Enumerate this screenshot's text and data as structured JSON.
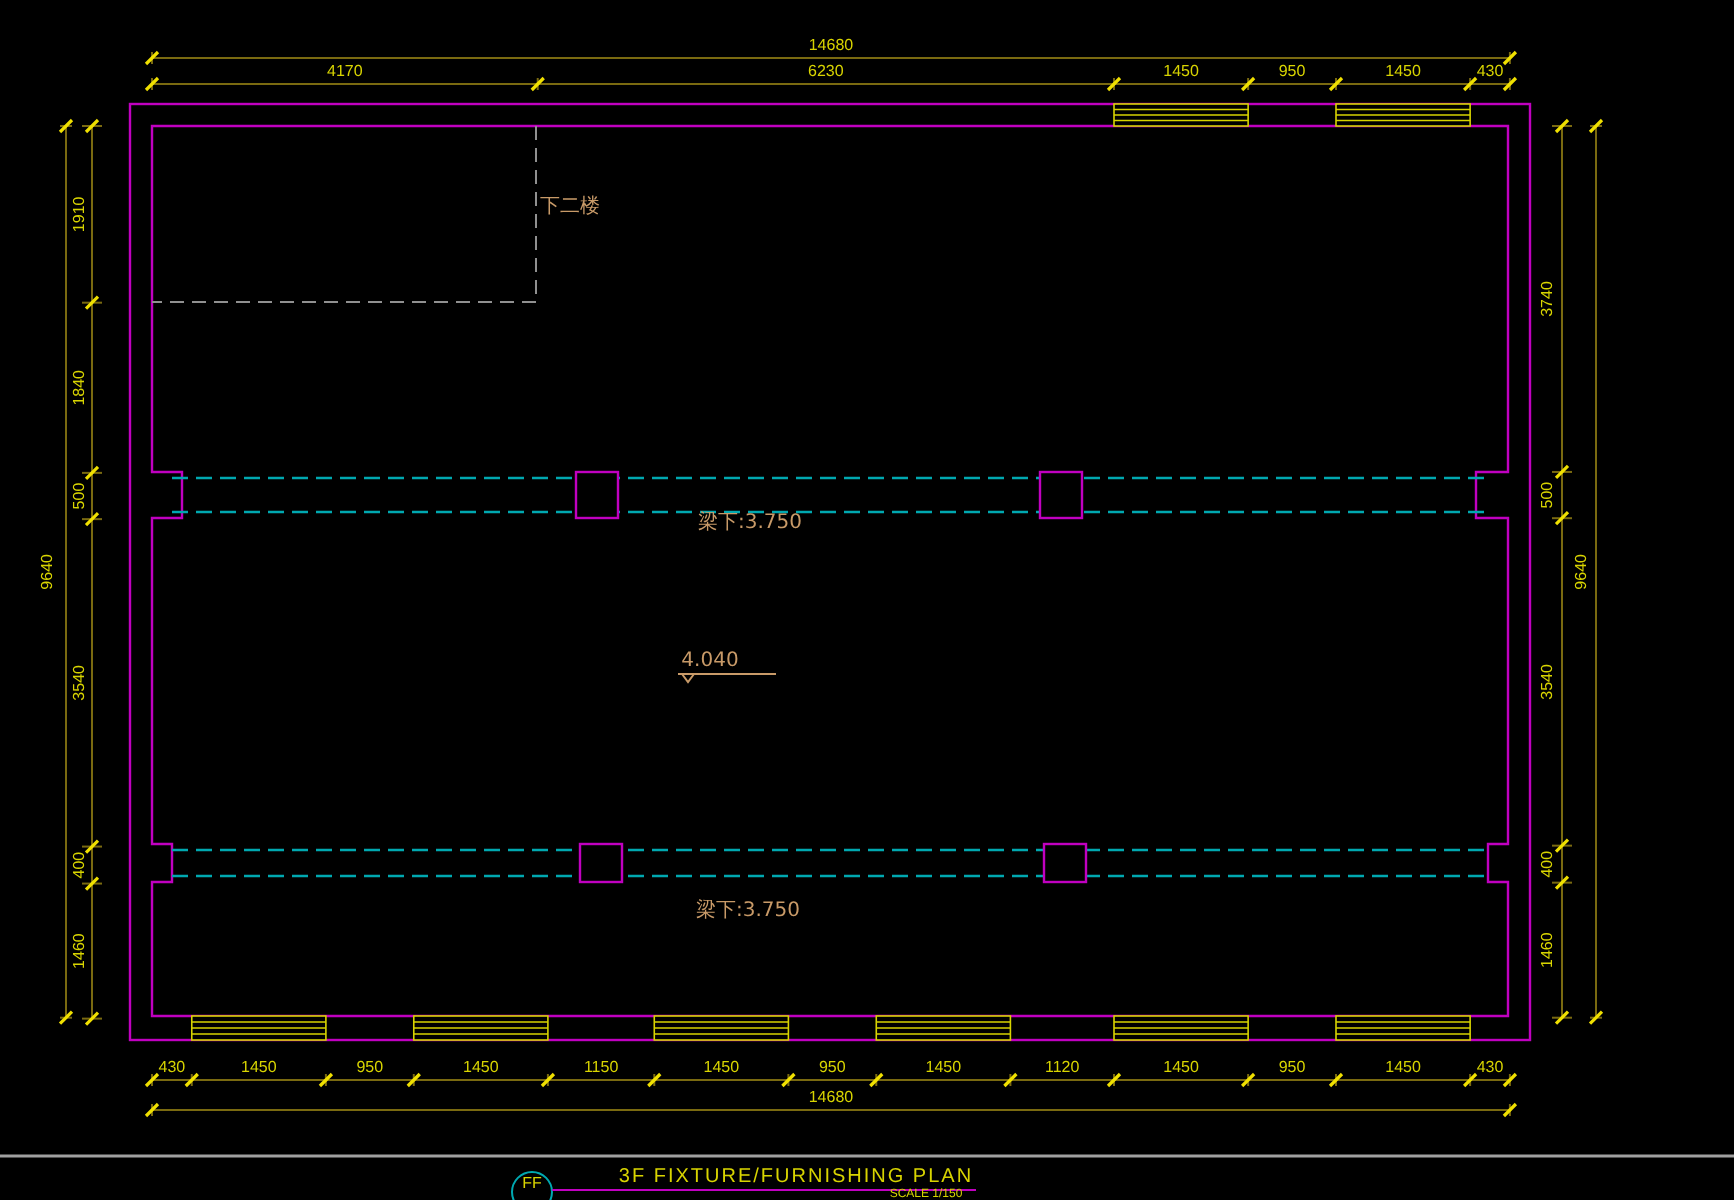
{
  "drawing": {
    "top_dims": {
      "total": "14680",
      "segments": [
        "4170",
        "6230",
        "1450",
        "950",
        "1450",
        "430"
      ]
    },
    "bottom_dims": {
      "segments": [
        "430",
        "1450",
        "950",
        "1450",
        "1150",
        "1450",
        "950",
        "1450",
        "1120",
        "1450",
        "950",
        "1450",
        "430"
      ],
      "total": "14680"
    },
    "left_dims": {
      "total": "9640",
      "segments": [
        "1910",
        "1840",
        "500",
        "3540",
        "400",
        "1460"
      ]
    },
    "right_dims": {
      "total": "9640",
      "segments": [
        "3740",
        "500",
        "3540",
        "400",
        "1460"
      ]
    },
    "labels": [
      {
        "kind": "note",
        "text": "下二楼"
      },
      {
        "kind": "note",
        "text": "梁下:3.750"
      },
      {
        "kind": "level",
        "text": "4.040"
      },
      {
        "kind": "note",
        "text": "梁下:3.750"
      }
    ],
    "title_block": {
      "badge": "FF",
      "title": "3F FIXTURE/FURNISHING PLAN",
      "scale": "SCALE 1/150"
    }
  }
}
